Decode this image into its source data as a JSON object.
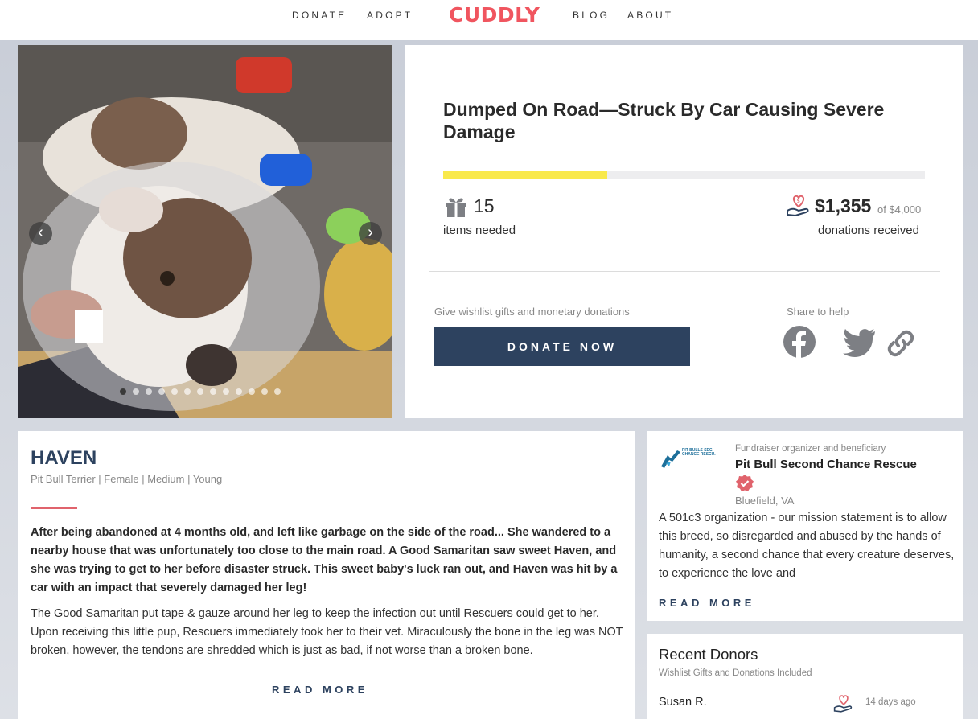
{
  "nav": {
    "links_left": [
      "DONATE",
      "ADOPT"
    ],
    "logo": "CUDDLY",
    "links_right": [
      "BLOG",
      "ABOUT"
    ]
  },
  "carousel": {
    "prev_icon": "chevron-left-icon",
    "next_icon": "chevron-right-icon",
    "slide_count": 13,
    "active_slide": 1
  },
  "campaign": {
    "title": "Dumped On Road—Struck By Car Causing Severe Damage",
    "progress_fraction": 0.34,
    "items_count": "15",
    "items_label": "items needed",
    "raised": "$1,355",
    "goal": "of $4,000",
    "donations_label": "donations received",
    "give_label": "Give wishlist gifts and monetary donations",
    "donate_button": "DONATE NOW",
    "share_label": "Share to help",
    "share_icons": [
      "facebook-icon",
      "twitter-icon",
      "link-icon"
    ]
  },
  "pet": {
    "name": "HAVEN",
    "attributes": "Pit Bull Terrier | Female | Medium | Young",
    "story_intro": "After being abandoned at 4 months old, and left like garbage on the side of the road... She wandered to a nearby house that was unfortunately too close to the main road. A Good Samaritan saw sweet Haven, and she was trying to get to her before disaster struck. This sweet baby's luck ran out, and Haven was hit by a car with an impact that severely damaged her leg!",
    "story_body": "The Good Samaritan put tape & gauze around her leg to keep the infection out until Rescuers could get to her. Upon receiving this little pup, Rescuers immediately took her to their vet. Miraculously the bone in the leg was NOT broken, however, the tendons are shredded which is just as bad, if not worse than a broken bone.",
    "read_more": "READ MORE"
  },
  "organization": {
    "logo_text": "PIT BULLS SEC. CHANCE RESCU.",
    "meta": "Fundraiser organizer and beneficiary",
    "name": "Pit Bull Second Chance Rescue",
    "location": "Bluefield,  VA",
    "description": "A 501c3 organization - our mission statement is to allow this breed, so disregarded and abused by the hands of humanity, a second chance that every creature deserves, to experience the love and",
    "read_more": "READ MORE"
  },
  "donors": {
    "title": "Recent Donors",
    "subtitle": "Wishlist Gifts and Donations Included",
    "list": [
      {
        "name": "Susan R.",
        "time": "14 days ago"
      }
    ]
  },
  "colors": {
    "brand": "#f0555f",
    "navy": "#2d425f",
    "progress": "#f9e94b"
  }
}
